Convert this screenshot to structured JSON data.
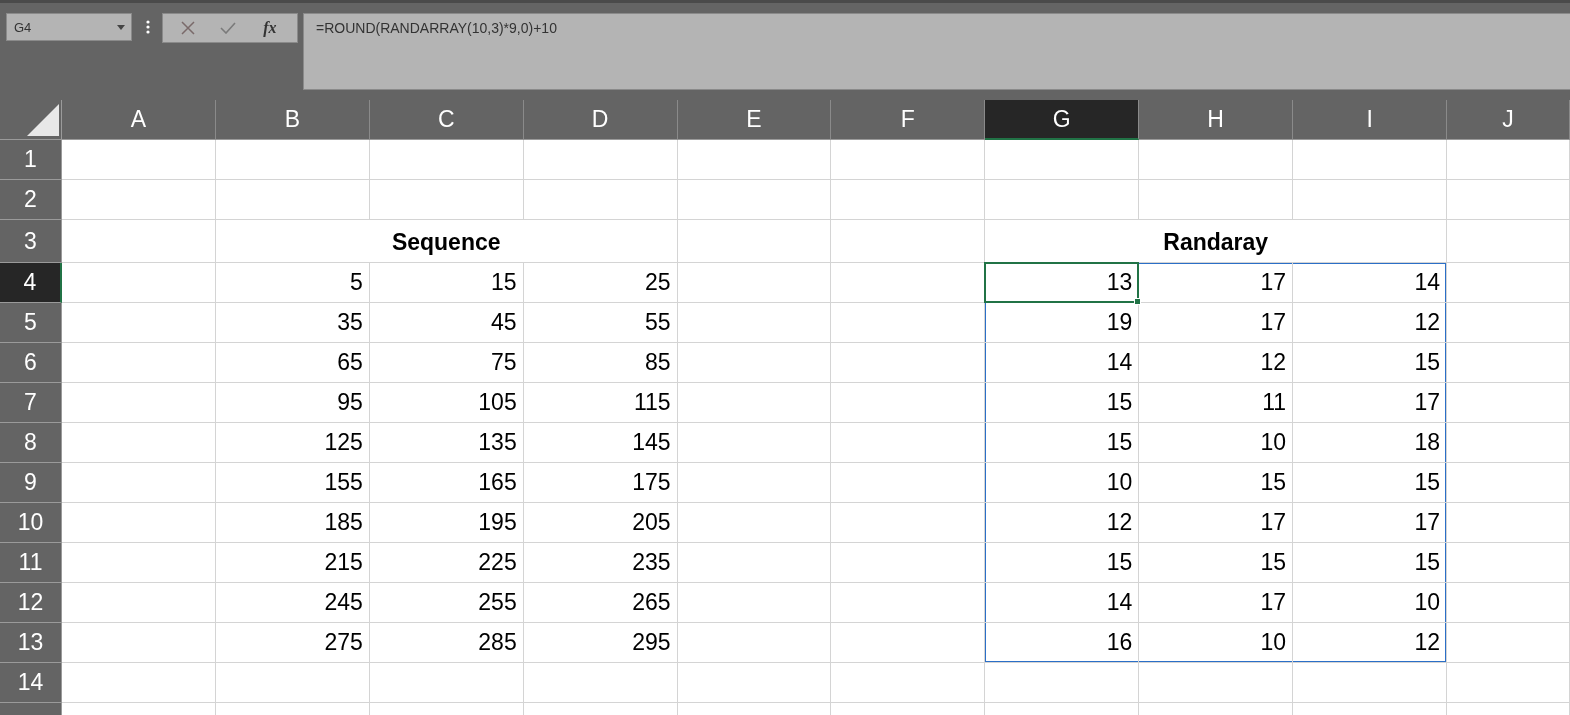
{
  "name_box": {
    "value": "G4"
  },
  "formula_bar": {
    "function_button": "fx",
    "formula": "=ROUND(RANDARRAY(10,3)*9,0)+10"
  },
  "columns": [
    {
      "label": "A",
      "selected": false
    },
    {
      "label": "B",
      "selected": false
    },
    {
      "label": "C",
      "selected": false
    },
    {
      "label": "D",
      "selected": false
    },
    {
      "label": "E",
      "selected": false
    },
    {
      "label": "F",
      "selected": false
    },
    {
      "label": "G",
      "selected": true
    },
    {
      "label": "H",
      "selected": false
    },
    {
      "label": "I",
      "selected": false
    },
    {
      "label": "J",
      "selected": false
    }
  ],
  "rows": [
    {
      "label": "1",
      "selected": false,
      "kind": "data",
      "cells": {}
    },
    {
      "label": "2",
      "selected": false,
      "kind": "data",
      "cells": {}
    },
    {
      "label": "3",
      "selected": false,
      "kind": "heading",
      "cells": {
        "B": "Sequence",
        "G": "Randaray"
      }
    },
    {
      "label": "4",
      "selected": true,
      "kind": "data",
      "cells": {
        "B": "5",
        "C": "15",
        "D": "25",
        "G": {
          "text": "13",
          "spill": true
        },
        "H": {
          "text": "17",
          "spill": true
        },
        "I": {
          "text": "14",
          "spill": true
        }
      }
    },
    {
      "label": "5",
      "selected": false,
      "kind": "data",
      "cells": {
        "B": "35",
        "C": "45",
        "D": "55",
        "G": {
          "text": "19",
          "spill": true
        },
        "H": {
          "text": "17",
          "spill": true
        },
        "I": {
          "text": "12",
          "spill": true
        }
      }
    },
    {
      "label": "6",
      "selected": false,
      "kind": "data",
      "cells": {
        "B": "65",
        "C": "75",
        "D": "85",
        "G": {
          "text": "14",
          "spill": true
        },
        "H": {
          "text": "12",
          "spill": true
        },
        "I": {
          "text": "15",
          "spill": true
        }
      }
    },
    {
      "label": "7",
      "selected": false,
      "kind": "data",
      "cells": {
        "B": "95",
        "C": "105",
        "D": "115",
        "G": {
          "text": "15",
          "spill": true
        },
        "H": {
          "text": "11",
          "spill": true
        },
        "I": {
          "text": "17",
          "spill": true
        }
      }
    },
    {
      "label": "8",
      "selected": false,
      "kind": "data",
      "cells": {
        "B": "125",
        "C": "135",
        "D": "145",
        "G": {
          "text": "15",
          "spill": true
        },
        "H": {
          "text": "10",
          "spill": true
        },
        "I": {
          "text": "18",
          "spill": true
        }
      }
    },
    {
      "label": "9",
      "selected": false,
      "kind": "data",
      "cells": {
        "B": "155",
        "C": "165",
        "D": "175",
        "G": {
          "text": "10",
          "spill": true
        },
        "H": {
          "text": "15",
          "spill": true
        },
        "I": {
          "text": "15",
          "spill": true
        }
      }
    },
    {
      "label": "10",
      "selected": false,
      "kind": "data",
      "cells": {
        "B": "185",
        "C": "195",
        "D": "205",
        "G": {
          "text": "12",
          "spill": true
        },
        "H": {
          "text": "17",
          "spill": true
        },
        "I": {
          "text": "17",
          "spill": true
        }
      }
    },
    {
      "label": "11",
      "selected": false,
      "kind": "data",
      "cells": {
        "B": "215",
        "C": "225",
        "D": "235",
        "G": {
          "text": "15",
          "spill": true
        },
        "H": {
          "text": "15",
          "spill": true
        },
        "I": {
          "text": "15",
          "spill": true
        }
      }
    },
    {
      "label": "12",
      "selected": false,
      "kind": "data",
      "cells": {
        "B": "245",
        "C": "255",
        "D": "265",
        "G": {
          "text": "14",
          "spill": true
        },
        "H": {
          "text": "17",
          "spill": true
        },
        "I": {
          "text": "10",
          "spill": true
        }
      }
    },
    {
      "label": "13",
      "selected": false,
      "kind": "data",
      "cells": {
        "B": "275",
        "C": "285",
        "D": "295",
        "G": {
          "text": "16",
          "spill": true
        },
        "H": {
          "text": "10",
          "spill": true
        },
        "I": {
          "text": "12",
          "spill": true
        }
      }
    },
    {
      "label": "14",
      "selected": false,
      "kind": "data",
      "cells": {}
    },
    {
      "selected": false,
      "kind": "data",
      "cells": {}
    }
  ]
}
